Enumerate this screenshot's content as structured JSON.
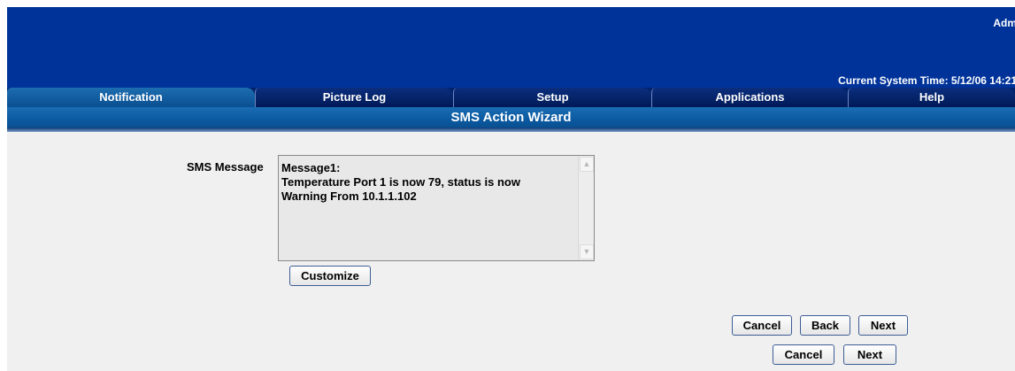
{
  "header": {
    "admin_label": "Adm",
    "system_time": "Current System Time: 5/12/06 14:21"
  },
  "tabs": [
    {
      "label": "Notification",
      "active": true
    },
    {
      "label": "Picture Log",
      "active": false
    },
    {
      "label": "Setup",
      "active": false
    },
    {
      "label": "Applications",
      "active": false
    },
    {
      "label": "Help",
      "active": false
    }
  ],
  "wizard": {
    "title": "SMS Action Wizard",
    "sms_label": "SMS Message",
    "message": "Message1:\nTemperature Port 1 is now 79, status is now\nWarning From 10.1.1.102",
    "customize_label": "Customize"
  },
  "buttons": {
    "row1": {
      "cancel": "Cancel",
      "back": "Back",
      "next": "Next"
    },
    "row2": {
      "cancel": "Cancel",
      "next": "Next"
    }
  },
  "colors": {
    "header_bg": "#003399",
    "active_tab": "#1d6db0",
    "content_bg": "#f0f0f0"
  }
}
